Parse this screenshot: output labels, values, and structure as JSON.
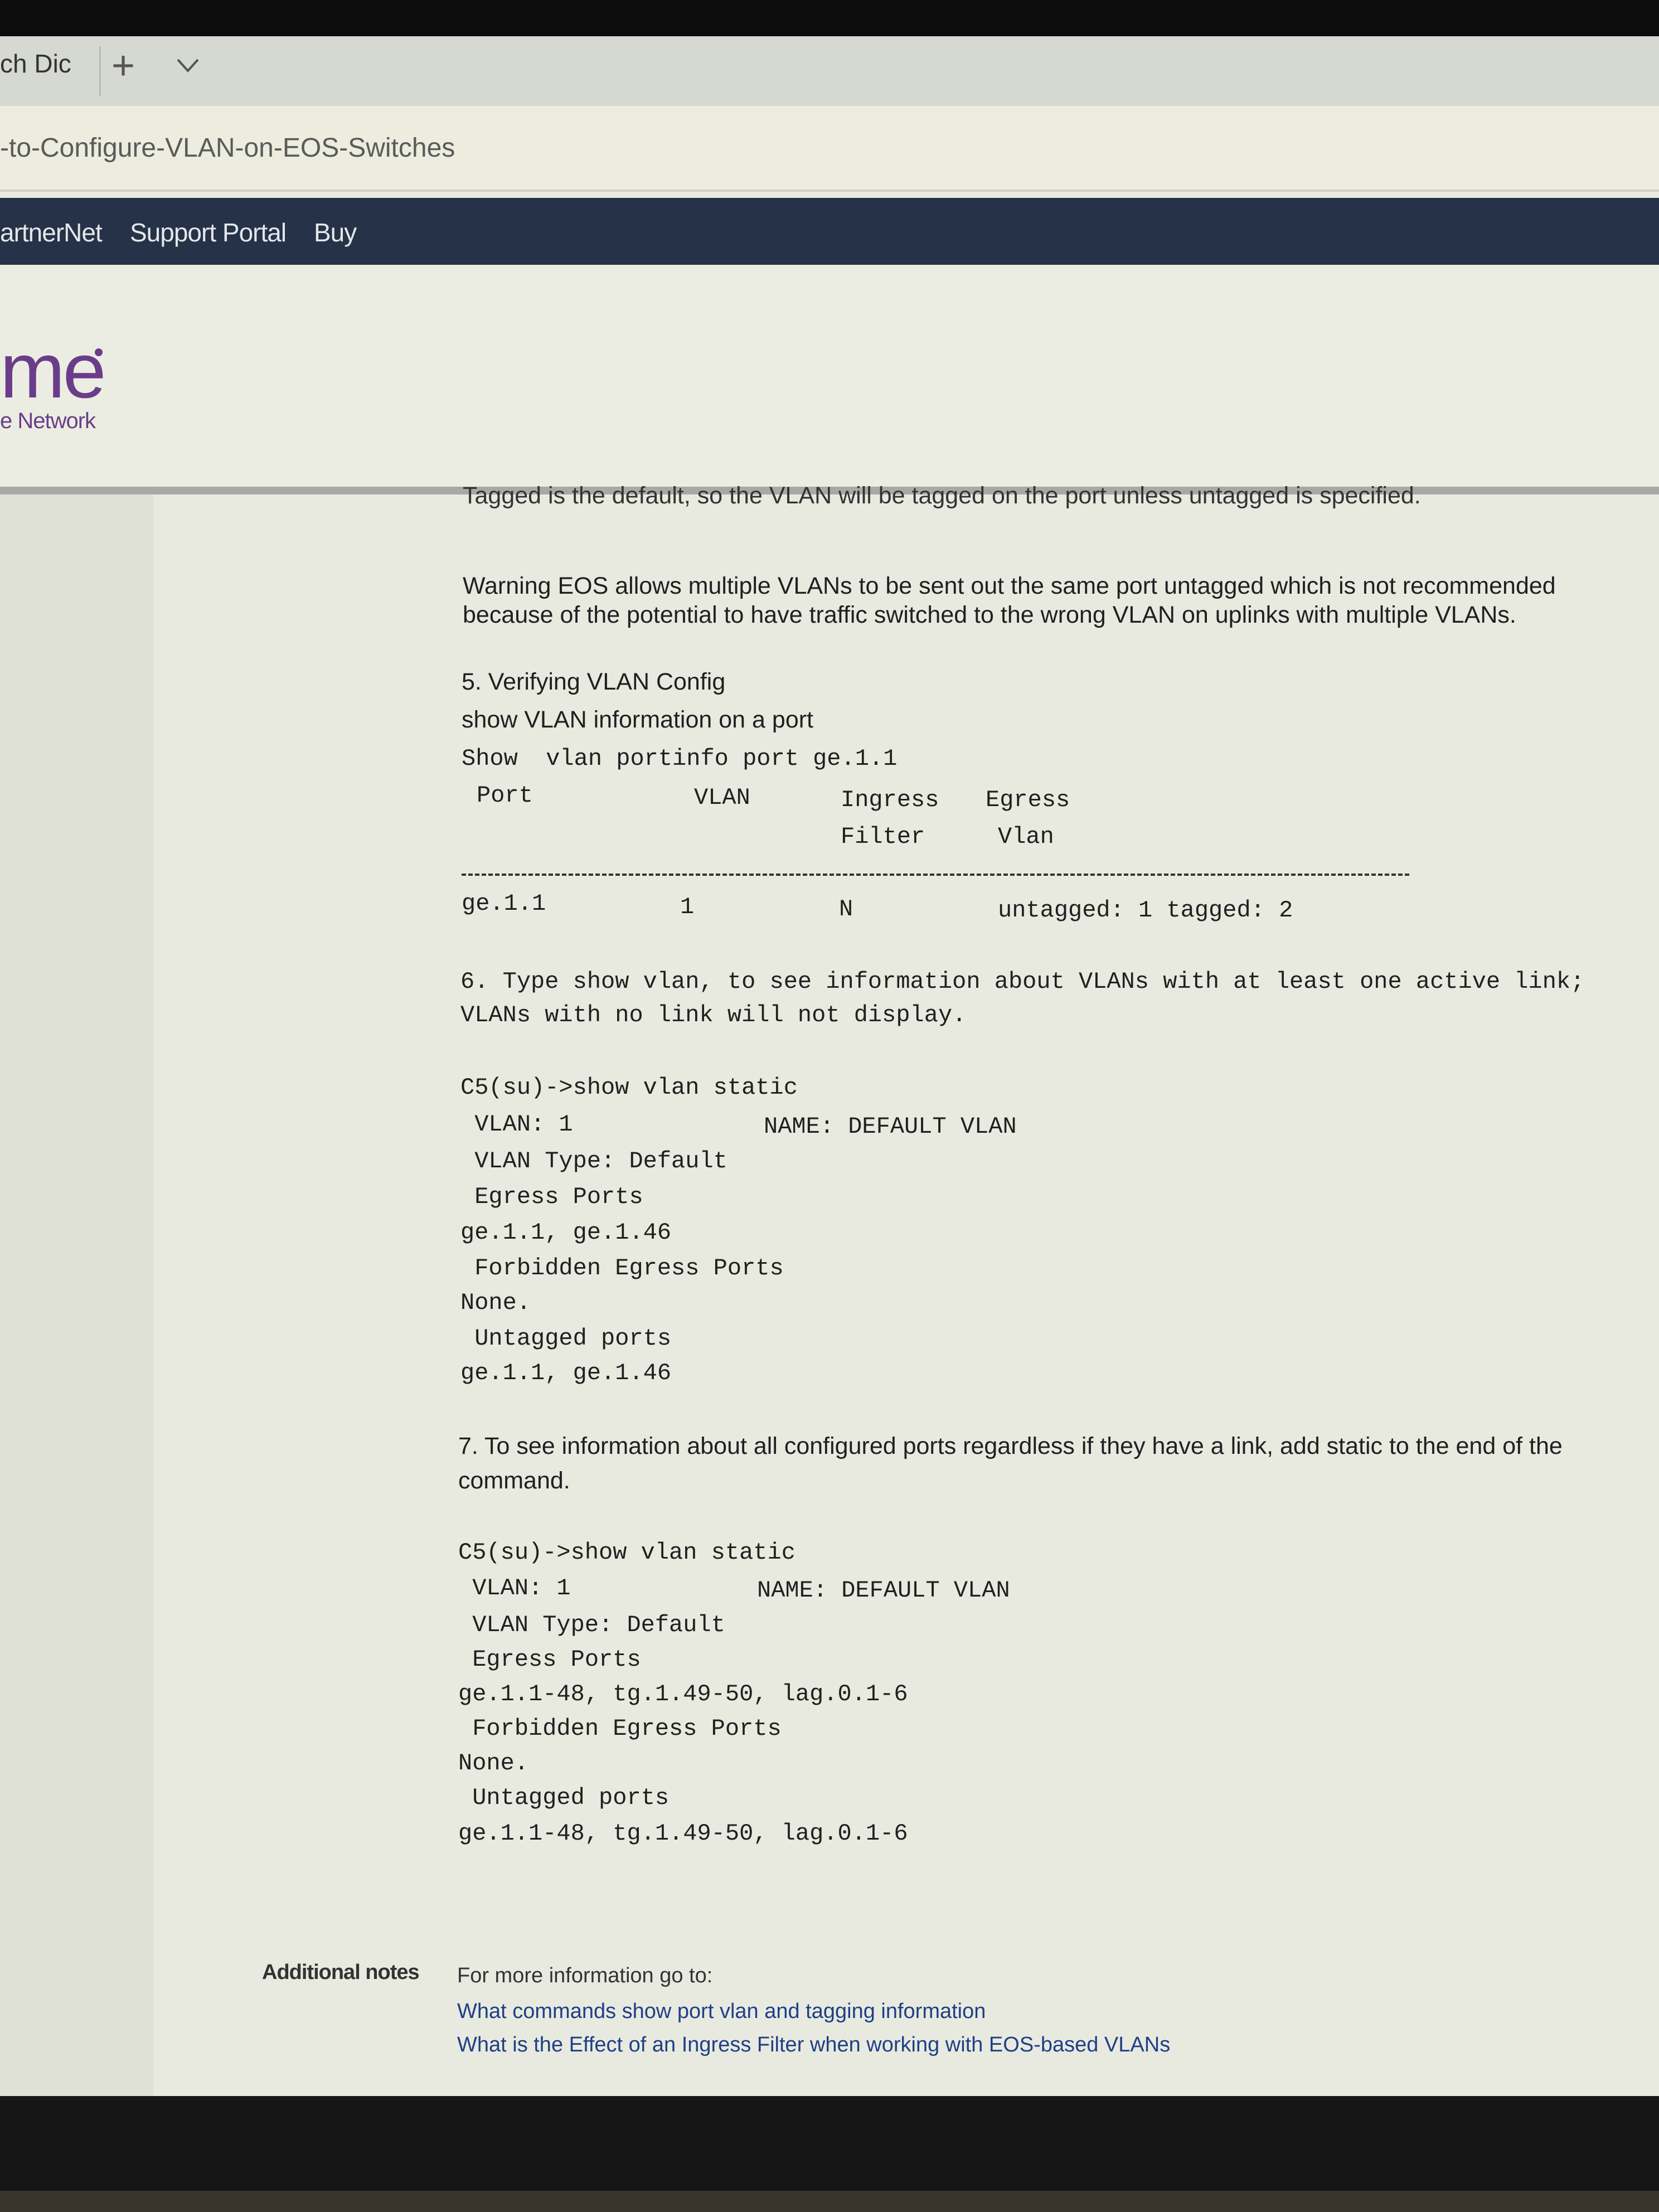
{
  "browser": {
    "tab_title": "ch Dic",
    "new_tab_symbol": "+",
    "url": "-to-Configure-VLAN-on-EOS-Switches"
  },
  "site_nav": {
    "items": [
      "artnerNet",
      "Support Portal",
      "Buy"
    ]
  },
  "logo": {
    "wordmark": "me",
    "tagline": "e Network"
  },
  "article": {
    "clipped_line": "Tagged is the default, so the VLAN will be tagged on the port unless untagged is specified.",
    "warning_line1": "Warning EOS allows multiple VLANs to be sent out the same port untagged which is not recommended",
    "warning_line2": "because of the  potential to have traffic switched to the wrong VLAN on uplinks with multiple VLANs.",
    "step5_title": "5.  Verifying VLAN Config",
    "step5_sub": "show VLAN information on a port",
    "step5_cmd": "Show  vlan portinfo port ge.1.1",
    "portinfo_headers": {
      "port": "Port",
      "vlan": "VLAN",
      "ingress": "Ingress",
      "filter": "Filter",
      "egress": "Egress",
      "egress_vlan": "Vlan"
    },
    "portinfo_row": {
      "port": "ge.1.1",
      "vlan": "1",
      "ingress_filter": "N",
      "egress_vlan": "untagged: 1 tagged: 2"
    },
    "step6_line1": "6. Type show vlan, to see information about VLANs with at least one active link;",
    "step6_line2": "VLANs with no link will not display.",
    "block1": {
      "cmd": "C5(su)->show vlan static",
      "vlan": " VLAN: 1",
      "name": "NAME: DEFAULT VLAN",
      "type": " VLAN Type: Default",
      "egress_label": " Egress Ports",
      "egress_value": "ge.1.1, ge.1.46",
      "forbidden_label": " Forbidden Egress Ports",
      "forbidden_value": "None.",
      "untagged_label": " Untagged ports",
      "untagged_value": "ge.1.1, ge.1.46"
    },
    "step7_line1": "7.  To see information about  all configured ports regardless if they have a link, add static to the end of the",
    "step7_line2": "command.",
    "block2": {
      "cmd": "C5(su)->show vlan static",
      "vlan": " VLAN: 1",
      "name": "NAME: DEFAULT VLAN",
      "type": " VLAN Type: Default",
      "egress_label": " Egress Ports",
      "egress_value": "ge.1.1-48, tg.1.49-50, lag.0.1-6",
      "forbidden_label": " Forbidden Egress Ports",
      "forbidden_value": "None.",
      "untagged_label": " Untagged ports",
      "untagged_value": "ge.1.1-48, tg.1.49-50, lag.0.1-6"
    },
    "notes_label": "Additional notes",
    "notes_intro": "For more information go to:",
    "notes_links": [
      "What commands show port vlan and tagging information",
      "What is the Effect of an Ingress Filter when working with EOS-based VLANs"
    ]
  },
  "colors": {
    "nav_bg": "#253247",
    "brand_purple": "#6a3d8a",
    "link": "#1f3f86",
    "page_bg": "#e8eae0"
  }
}
